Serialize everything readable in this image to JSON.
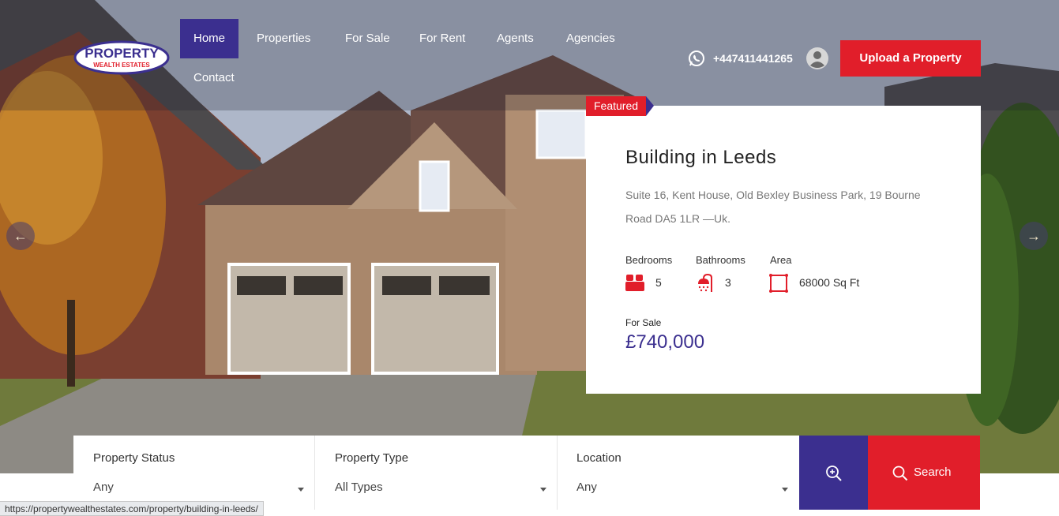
{
  "nav": {
    "items": [
      {
        "label": "Home"
      },
      {
        "label": "Properties"
      },
      {
        "label": "For Sale"
      },
      {
        "label": "For Rent"
      },
      {
        "label": "Agents"
      },
      {
        "label": "Agencies"
      },
      {
        "label": "Contact"
      }
    ]
  },
  "header": {
    "logo_top": "PROPERTY",
    "logo_bottom": "WEALTH ESTATES",
    "phone": "+447411441265",
    "upload_label": "Upload a Property"
  },
  "featured": {
    "tag": "Featured",
    "title": "Building in Leeds",
    "address": "Suite 16, Kent House, Old Bexley Business Park, 19 Bourne Road DA5 1LR —Uk.",
    "bedrooms_label": "Bedrooms",
    "bedrooms": "5",
    "bathrooms_label": "Bathrooms",
    "bathrooms": "3",
    "area_label": "Area",
    "area": "68000 Sq Ft",
    "status": "For Sale",
    "price": "£740,000"
  },
  "search": {
    "fields": [
      {
        "label": "Property Status",
        "value": "Any"
      },
      {
        "label": "Property Type",
        "value": "All Types"
      },
      {
        "label": "Location",
        "value": "Any"
      }
    ],
    "button_label": "Search"
  },
  "status_bar": {
    "url": "https://propertywealthestates.com/property/building-in-leeds/"
  },
  "colors": {
    "brand_purple": "#3b2f8f",
    "brand_red": "#e11e2a"
  },
  "icons": [
    "whatsapp-icon",
    "user-icon",
    "bed-icon",
    "shower-icon",
    "area-icon",
    "zoom-icon",
    "search-icon",
    "arrow-left-icon",
    "arrow-right-icon"
  ]
}
